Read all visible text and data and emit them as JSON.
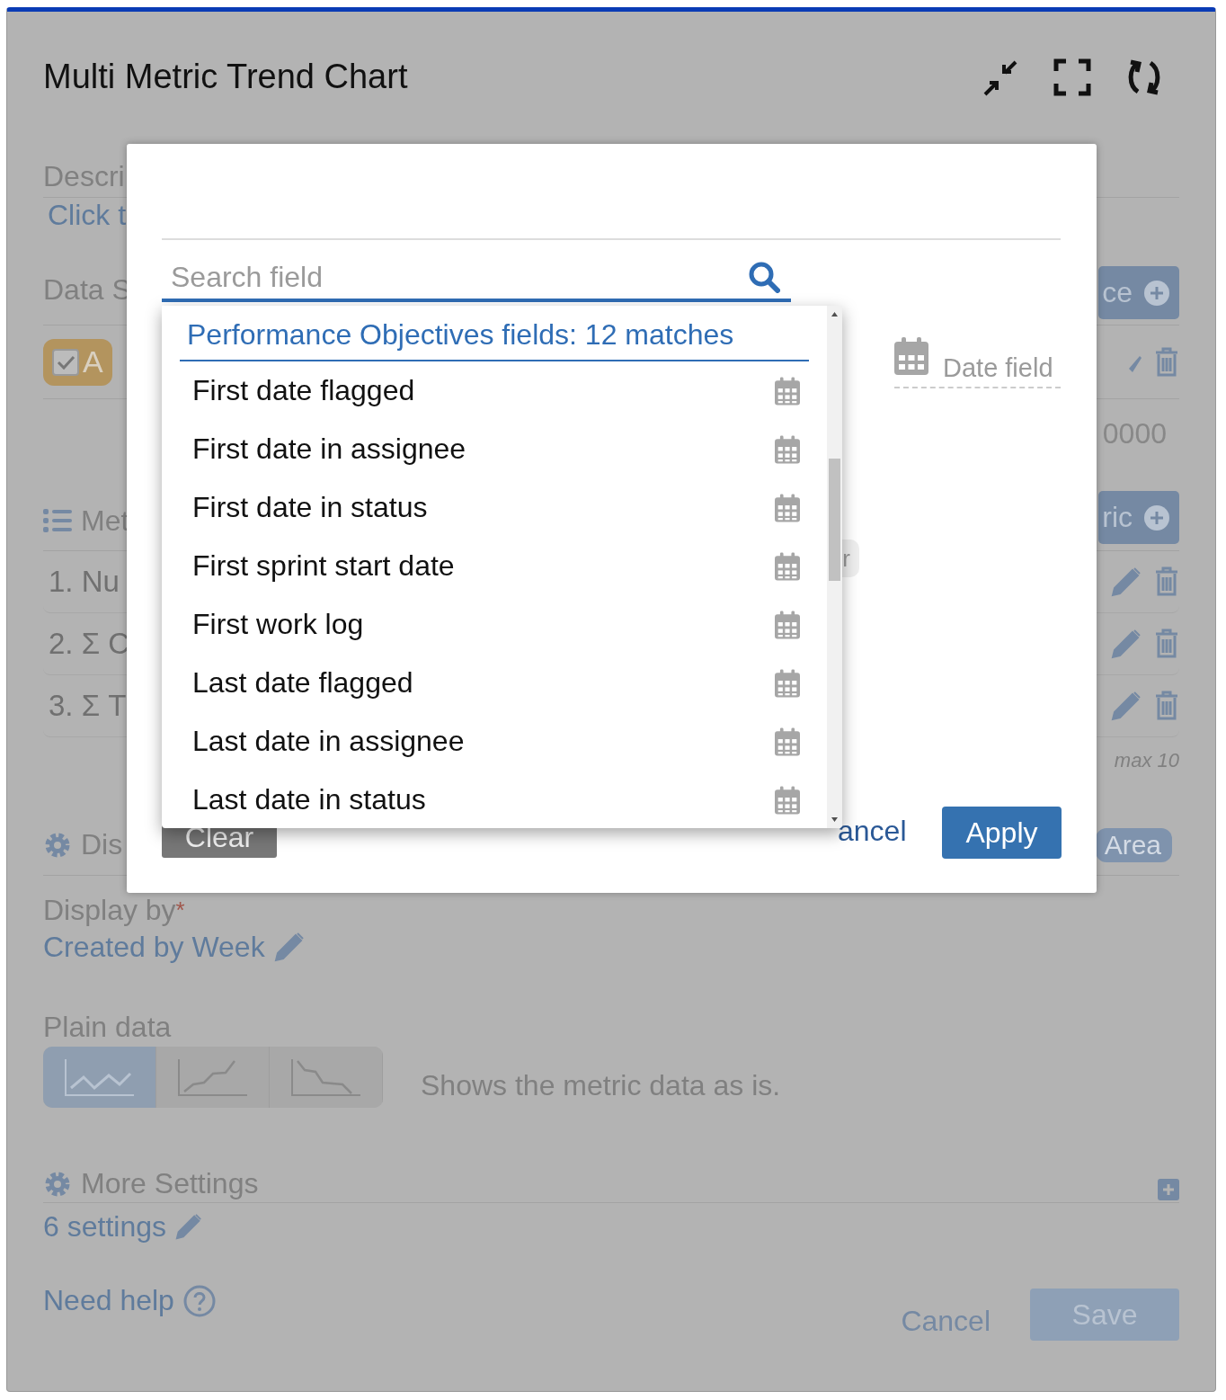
{
  "header": {
    "title": "Multi Metric Trend Chart"
  },
  "background": {
    "description_label": "Descri",
    "description_link": "Click t",
    "data_label": "Data S",
    "data_button": "ce",
    "source_chip": {
      "label": "A",
      "checked": true
    },
    "limit_value": "0000",
    "metrics_label": "Met",
    "metrics_button": "ric",
    "metrics": [
      {
        "text": "1. Nu"
      },
      {
        "text": "2. Σ C"
      },
      {
        "text": "3. Σ T"
      }
    ],
    "metrics_hint": "max 10",
    "display_label": "Dis",
    "display_chip": "Area",
    "display_by_label": "Display by",
    "display_by_required": "*",
    "display_by_value": "Created by Week",
    "plain_data_label": "Plain data",
    "modes": [
      {
        "kind": "zigzag",
        "selected": true
      },
      {
        "kind": "rising",
        "selected": false
      },
      {
        "kind": "falling",
        "selected": false
      }
    ],
    "mode_description": "Shows the metric data as is.",
    "more_settings_label": "More Settings",
    "settings_link": "6 settings",
    "help_link": "Need help",
    "cancel": "Cancel",
    "save": "Save"
  },
  "dialog": {
    "search": {
      "placeholder": "Search field"
    },
    "date_field": "Date field",
    "chip_text": "r",
    "clear": "Clear",
    "cancel": "ancel",
    "apply": "Apply",
    "dropdown": {
      "group": "Performance Objectives fields: 12 matches",
      "options": [
        {
          "label": "First date flagged",
          "selected": false
        },
        {
          "label": "First date in assignee",
          "selected": false
        },
        {
          "label": "First date in status",
          "selected": false
        },
        {
          "label": "First sprint start date",
          "selected": false
        },
        {
          "label": "First work log",
          "selected": false
        },
        {
          "label": "Last date flagged",
          "selected": false
        },
        {
          "label": "Last date in assignee",
          "selected": false
        },
        {
          "label": "Last date in status",
          "selected": false
        }
      ]
    }
  }
}
